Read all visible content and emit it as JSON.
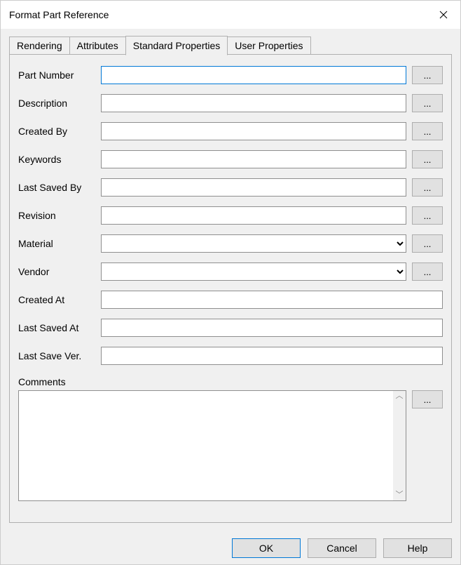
{
  "window": {
    "title": "Format Part Reference"
  },
  "tabs": [
    {
      "label": "Rendering"
    },
    {
      "label": "Attributes"
    },
    {
      "label": "Standard Properties"
    },
    {
      "label": "User Properties"
    }
  ],
  "active_tab_index": 2,
  "fields": {
    "part_number": {
      "label": "Part Number",
      "value": "",
      "browse": "..."
    },
    "description": {
      "label": "Description",
      "value": "",
      "browse": "..."
    },
    "created_by": {
      "label": "Created By",
      "value": "",
      "browse": "..."
    },
    "keywords": {
      "label": "Keywords",
      "value": "",
      "browse": "..."
    },
    "last_saved_by": {
      "label": "Last Saved By",
      "value": "",
      "browse": "..."
    },
    "revision": {
      "label": "Revision",
      "value": "",
      "browse": "..."
    },
    "material": {
      "label": "Material",
      "value": "",
      "browse": "..."
    },
    "vendor": {
      "label": "Vendor",
      "value": "",
      "browse": "..."
    },
    "created_at": {
      "label": "Created At",
      "value": ""
    },
    "last_saved_at": {
      "label": "Last Saved At",
      "value": ""
    },
    "last_save_ver": {
      "label": "Last Save Ver.",
      "value": ""
    }
  },
  "comments": {
    "label": "Comments",
    "value": "",
    "browse": "..."
  },
  "buttons": {
    "ok": "OK",
    "cancel": "Cancel",
    "help": "Help"
  }
}
